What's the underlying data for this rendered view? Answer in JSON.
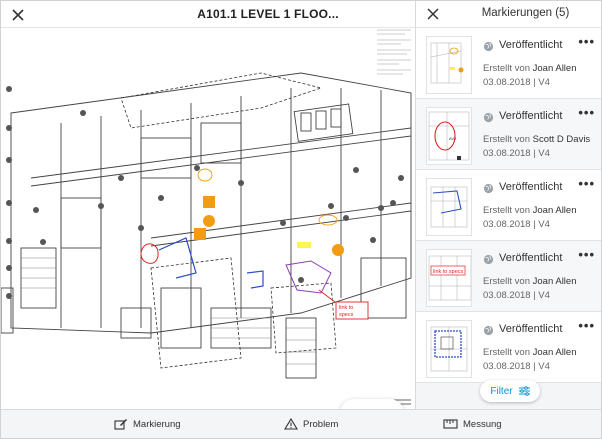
{
  "header": {
    "title": "A101.1 LEVEL 1 FLOO..."
  },
  "drawing": {
    "callout_text": "link to specs",
    "nav_prev": "‹",
    "nav_next": "›"
  },
  "panel": {
    "title": "Markierungen (5)",
    "more_label": "•••",
    "items": [
      {
        "status": "Veröffentlicht",
        "created_by_prefix": "Erstellt von",
        "author": "Joan Allen",
        "date": "03.08.2018",
        "separator": "|",
        "version": "V4",
        "thumb_text": ""
      },
      {
        "status": "Veröffentlicht",
        "created_by_prefix": "Erstellt von",
        "author": "Scott D Davis",
        "date": "03.08.2018",
        "separator": "|",
        "version": "V4",
        "thumb_text": ""
      },
      {
        "status": "Veröffentlicht",
        "created_by_prefix": "Erstellt von",
        "author": "Joan Allen",
        "date": "03.08.2018",
        "separator": "|",
        "version": "V4",
        "thumb_text": ""
      },
      {
        "status": "Veröffentlicht",
        "created_by_prefix": "Erstellt von",
        "author": "Joan Allen",
        "date": "03.08.2018",
        "separator": "|",
        "version": "V4",
        "thumb_text": "link to specs"
      },
      {
        "status": "Veröffentlicht",
        "created_by_prefix": "Erstellt von",
        "author": "Joan Allen",
        "date": "03.08.2018",
        "separator": "|",
        "version": "V4",
        "thumb_text": ""
      }
    ],
    "filter_label": "Filter"
  },
  "toolbar": {
    "markup_label": "Markierung",
    "problem_label": "Problem",
    "measure_label": "Messung"
  },
  "colors": {
    "accent": "#0696d7",
    "orange": "#f39c12",
    "markup_red": "#e02424",
    "markup_blue": "#2b4ec9",
    "markup_purple": "#8b3fb8"
  }
}
